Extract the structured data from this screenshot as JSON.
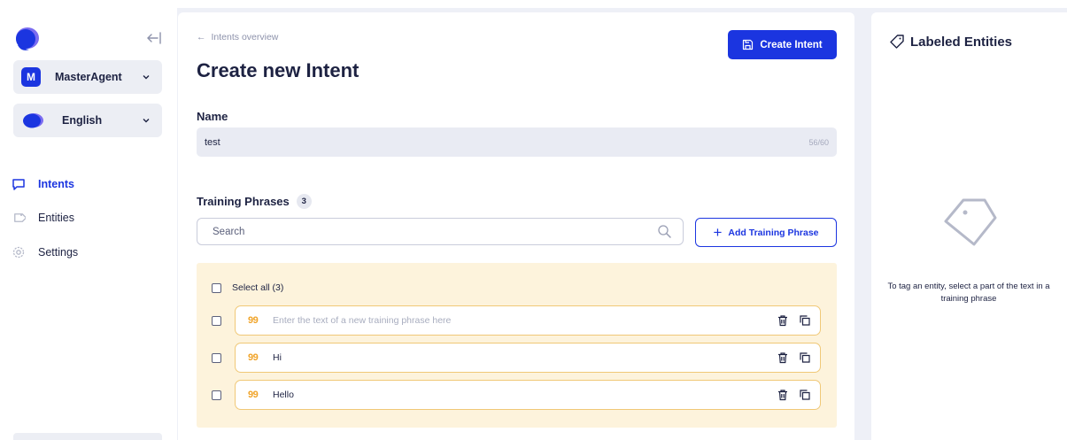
{
  "sidebar": {
    "agent_select": {
      "avatar_letter": "M",
      "label": "MasterAgent"
    },
    "language_select": {
      "label": "English"
    },
    "nav": [
      {
        "label": "Intents",
        "icon": "chat-bubble-icon",
        "active": true
      },
      {
        "label": "Entities",
        "icon": "tag-icon",
        "active": false
      },
      {
        "label": "Settings",
        "icon": "gear-icon",
        "active": false
      }
    ]
  },
  "main": {
    "breadcrumb": "Intents overview",
    "title": "Create new Intent",
    "create_button": "Create Intent",
    "name": {
      "label": "Name",
      "value": "test",
      "counter": "56/60"
    },
    "training": {
      "label": "Training Phrases",
      "count": "3",
      "search_placeholder": "Search",
      "add_button": "Add Training Phrase",
      "select_all": "Select all (3)",
      "new_phrase_placeholder": "Enter the text of a new training phrase here",
      "phrases": [
        "Hi",
        "Hello"
      ]
    }
  },
  "right": {
    "title": "Labeled Entities",
    "hint": "To tag an entity, select a part of the text in a training phrase"
  },
  "colors": {
    "accent": "#1b35e0",
    "phrase_area": "#fdf3dc",
    "quote_mark": "#f0a42a"
  }
}
